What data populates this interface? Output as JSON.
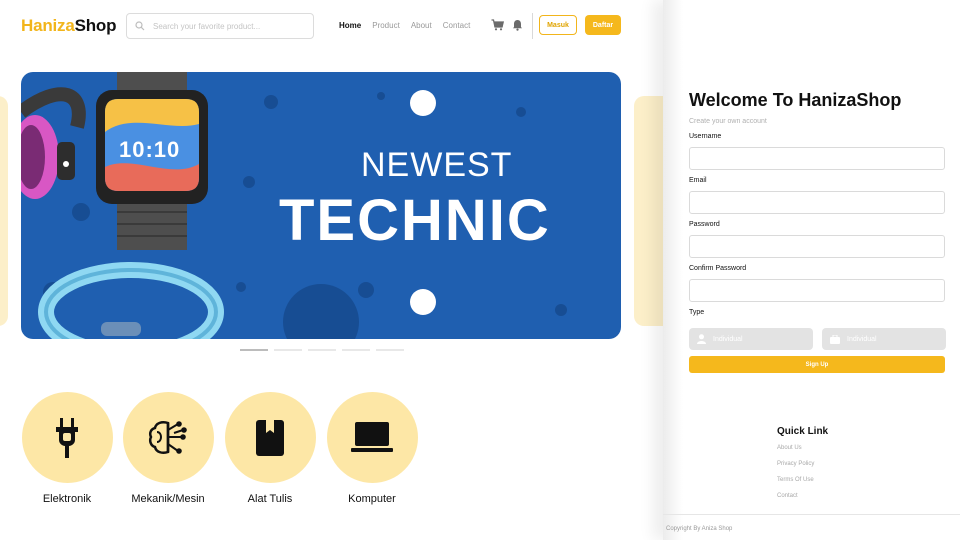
{
  "brand": {
    "name_part1": "Haniza",
    "name_part2": "Shop",
    "accent": "#f5b81c"
  },
  "search": {
    "placeholder": "Search your favorite product..."
  },
  "nav": {
    "items": [
      {
        "label": "Home",
        "active": true
      },
      {
        "label": "Product"
      },
      {
        "label": "About"
      },
      {
        "label": "Contact"
      }
    ]
  },
  "header": {
    "icons": [
      "cart-icon",
      "bell-icon"
    ],
    "login_label": "Masuk",
    "register_label": "Daftar"
  },
  "banner": {
    "line1": "NEWEST",
    "line2": "TECHNIC",
    "watch_time": "10:10",
    "background": "#1f5fb0",
    "slide_count": 5,
    "active_slide": 0
  },
  "categories": [
    {
      "label": "Elektronik",
      "icon": "plug-icon"
    },
    {
      "label": "Mekanik/Mesin",
      "icon": "circuit-brain-icon"
    },
    {
      "label": "Alat Tulis",
      "icon": "book-icon"
    },
    {
      "label": "Komputer",
      "icon": "laptop-icon"
    }
  ],
  "signup_form": {
    "title": "Welcome To HanizaShop",
    "subtitle": "Create your own account",
    "fields": {
      "username": "Username",
      "email": "Email",
      "password": "Password",
      "confirm_password": "Confirm Password"
    },
    "type_label": "Type",
    "type_options": [
      {
        "label": "Individual",
        "icon": "user-icon"
      },
      {
        "label": "Individual",
        "icon": "briefcase-icon"
      }
    ],
    "submit_label": "Sign Up"
  },
  "quick_link": {
    "title": "Quick Link",
    "links": [
      "About Us",
      "Privacy Policy",
      "Terms Of Use",
      "Contact"
    ]
  },
  "footer": {
    "copyright": "Copyright By Aniza Shop"
  }
}
